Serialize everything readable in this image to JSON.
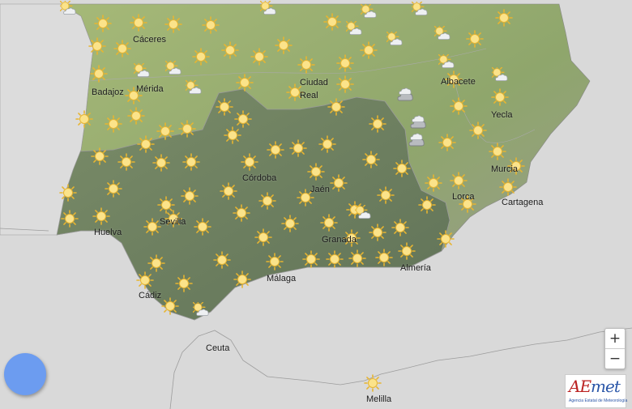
{
  "cities": [
    {
      "id": "caceres",
      "name": "Cáceres"
    },
    {
      "id": "badajoz",
      "name": "Badajoz"
    },
    {
      "id": "merida",
      "name": "Mérida"
    },
    {
      "id": "ciudad-real-1",
      "name": "Ciudad"
    },
    {
      "id": "ciudad-real-2",
      "name": "Real"
    },
    {
      "id": "albacete",
      "name": "Albacete"
    },
    {
      "id": "yecla",
      "name": "Yecla"
    },
    {
      "id": "murcia",
      "name": "Murcia"
    },
    {
      "id": "cordoba",
      "name": "Córdoba"
    },
    {
      "id": "jaen",
      "name": "Jaén"
    },
    {
      "id": "sevilla",
      "name": "Sevilla"
    },
    {
      "id": "huelva",
      "name": "Huelva"
    },
    {
      "id": "granada",
      "name": "Granada"
    },
    {
      "id": "lorca",
      "name": "Lorca"
    },
    {
      "id": "cartagena",
      "name": "Cartagena"
    },
    {
      "id": "almeria",
      "name": "Almería"
    },
    {
      "id": "malaga",
      "name": "Málaga"
    },
    {
      "id": "cadiz",
      "name": "Cádiz"
    },
    {
      "id": "ceuta",
      "name": "Ceuta"
    },
    {
      "id": "melilla",
      "name": "Melilla"
    }
  ],
  "zoom": {
    "in_label": "+",
    "out_label": "−"
  },
  "logo": {
    "text_a": "AE",
    "text_b": "met",
    "subtitle": "Agencia Estatal de Meteorología"
  },
  "icons": {
    "sun": "sun-icon",
    "sun_cloud": "sun-cloud-icon",
    "cloud": "cloud-icon"
  },
  "colors": {
    "sea": "#d9d9d9",
    "land": "#8ea66a",
    "andalucia": "#6e8060",
    "sun": "#f5c842"
  }
}
